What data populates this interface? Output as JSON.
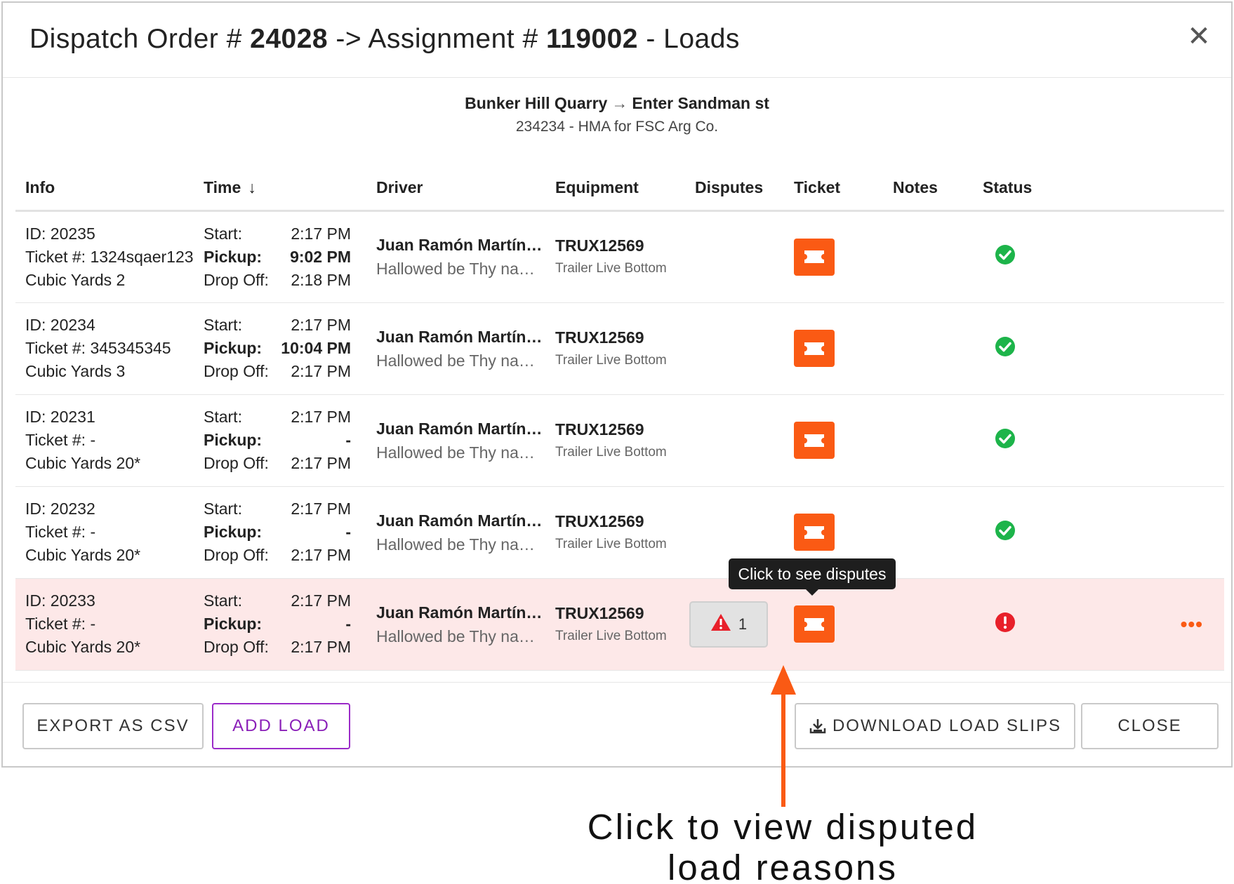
{
  "modal": {
    "title_prefix": "Dispatch Order # ",
    "order_number": "24028",
    "title_middle": " -> Assignment # ",
    "assignment_number": "119002",
    "title_suffix": " - Loads",
    "close_symbol": "✕"
  },
  "route": {
    "origin": "Bunker Hill Quarry",
    "arrow": "→",
    "destination": "Enter Sandman st",
    "job": "234234 - HMA for FSC Arg Co."
  },
  "columns": {
    "info": "Info",
    "time": "Time",
    "time_sort_icon": "↓",
    "driver": "Driver",
    "equipment": "Equipment",
    "disputes": "Disputes",
    "ticket": "Ticket",
    "notes": "Notes",
    "status": "Status"
  },
  "labels": {
    "start": "Start:",
    "pickup": "Pickup:",
    "drop_off": "Drop Off:"
  },
  "rows": [
    {
      "id": "ID: 20235",
      "ticket": "Ticket #: 1324sqaer123",
      "qty": "Cubic Yards 2",
      "start": "2:17 PM",
      "pickup": "9:02 PM",
      "drop_off": "2:18 PM",
      "driver_name": "Juan Ramón Martín Ruiz",
      "driver_sub": "Hallowed be Thy name Hauling",
      "equipment_id": "TRUX12569",
      "equipment_sub": "Trailer Live Bottom",
      "status": "check-circle-icon"
    },
    {
      "id": "ID: 20234",
      "ticket": "Ticket #: 345345345",
      "qty": "Cubic Yards 3",
      "start": "2:17 PM",
      "pickup": "10:04 PM",
      "drop_off": "2:17 PM",
      "driver_name": "Juan Ramón Martín Ruiz",
      "driver_sub": "Hallowed be Thy name Hauling",
      "equipment_id": "TRUX12569",
      "equipment_sub": "Trailer Live Bottom",
      "status": "check-circle-icon"
    },
    {
      "id": "ID: 20231",
      "ticket": "Ticket #: -",
      "qty": "Cubic Yards 20*",
      "start": "2:17 PM",
      "pickup": "-",
      "drop_off": "2:17 PM",
      "driver_name": "Juan Ramón Martín Ruiz",
      "driver_sub": "Hallowed be Thy name Hauling",
      "equipment_id": "TRUX12569",
      "equipment_sub": "Trailer Live Bottom",
      "status": "check-circle-icon"
    },
    {
      "id": "ID: 20232",
      "ticket": "Ticket #: -",
      "qty": "Cubic Yards 20*",
      "start": "2:17 PM",
      "pickup": "-",
      "drop_off": "2:17 PM",
      "driver_name": "Juan Ramón Martín Ruiz",
      "driver_sub": "Hallowed be Thy name Hauling",
      "equipment_id": "TRUX12569",
      "equipment_sub": "Trailer Live Bottom",
      "status": "check-circle-icon"
    },
    {
      "id": "ID: 20233",
      "ticket": "Ticket #: -",
      "qty": "Cubic Yards 20*",
      "start": "2:17 PM",
      "pickup": "-",
      "drop_off": "2:17 PM",
      "driver_name": "Juan Ramón Martín Ruiz",
      "driver_sub": "Hallowed be Thy name Hauling",
      "equipment_id": "TRUX12569",
      "equipment_sub": "Trailer Live Bottom",
      "dispute_count": "1",
      "status": "error-circle-icon",
      "more_symbol": "•••"
    }
  ],
  "tooltip": "Click to see disputes",
  "footer": {
    "export_csv": "EXPORT AS CSV",
    "add_load": "ADD LOAD",
    "download_slips": "DOWNLOAD LOAD SLIPS",
    "close": "CLOSE"
  },
  "annotation": {
    "line1": "Click to view disputed",
    "line2": "load reasons"
  },
  "colors": {
    "accent_orange": "#fa5a14",
    "success_green": "#1db44a",
    "error_red": "#e8202a",
    "disputed_row_bg": "#fde8e8",
    "add_load_purple": "#9b2bc8"
  }
}
